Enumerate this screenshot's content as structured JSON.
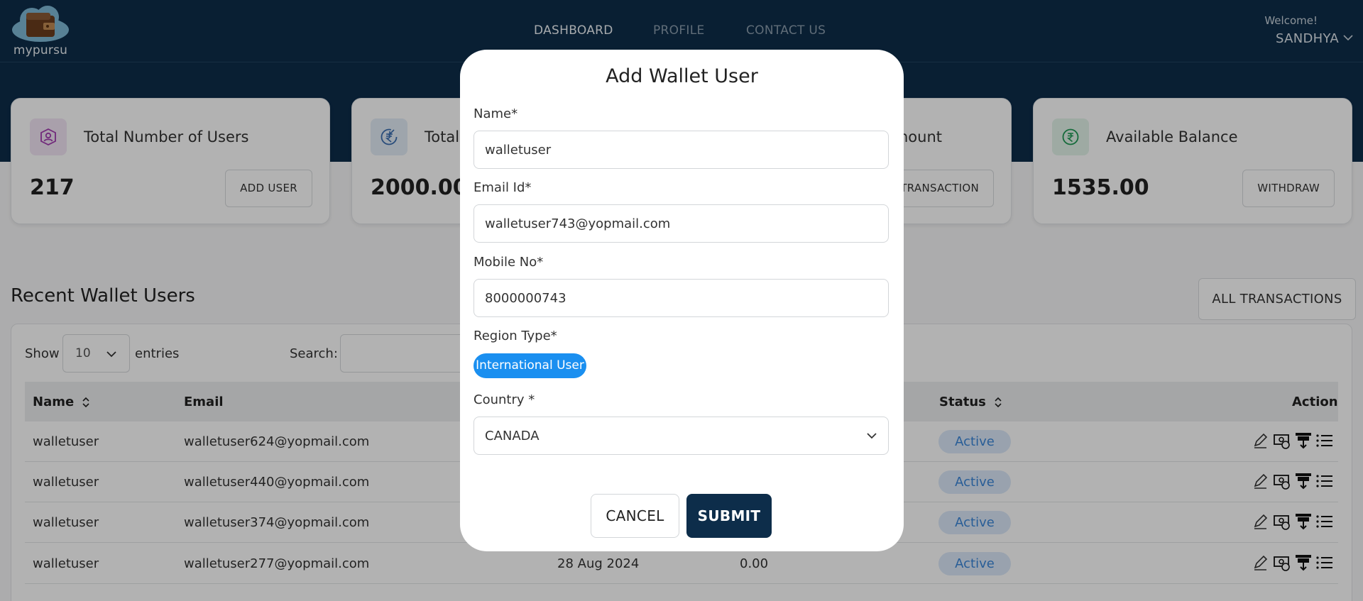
{
  "brand": {
    "name": "mypursu",
    "logo_icon": "wallet-cloud-logo"
  },
  "nav": [
    {
      "label": "DASHBOARD",
      "active": true
    },
    {
      "label": "PROFILE",
      "active": false
    },
    {
      "label": "CONTACT US",
      "active": false
    }
  ],
  "user": {
    "welcome": "Welcome!",
    "name": "SANDHYA"
  },
  "cards": [
    {
      "title": "Total Number of Users",
      "value": "217",
      "button": "ADD USER",
      "icon": "user-badge-icon",
      "icon_color": "#a23bb0",
      "icon_bg": "#f3e6f5"
    },
    {
      "title": "Total",
      "value": "2000.00",
      "button": "",
      "icon": "rupee-refund-icon",
      "icon_color": "#3b6fb0",
      "icon_bg": "#e3ecf7"
    },
    {
      "title": "nount",
      "value": "",
      "button": "TRANSACTION",
      "icon": "",
      "icon_color": "",
      "icon_bg": ""
    },
    {
      "title": "Available Balance",
      "value": "1535.00",
      "button": "WITHDRAW",
      "icon": "rupee-circle-icon",
      "icon_color": "#1f9a55",
      "icon_bg": "#e3f4ea"
    }
  ],
  "recent": {
    "title": "Recent Wallet Users",
    "all_transactions": "ALL TRANSACTIONS",
    "show_label": "Show",
    "page_length": "10",
    "entries_label": "entries",
    "search_label": "Search:"
  },
  "table": {
    "headers": {
      "name": "Name",
      "email": "Email",
      "status": "Status",
      "action": "Action"
    },
    "rows": [
      {
        "name": "walletuser",
        "email": "walletuser624@yopmail.com",
        "date": "",
        "amount": "",
        "status": "Active"
      },
      {
        "name": "walletuser",
        "email": "walletuser440@yopmail.com",
        "date": "",
        "amount": "",
        "status": "Active"
      },
      {
        "name": "walletuser",
        "email": "walletuser374@yopmail.com",
        "date": "",
        "amount": "",
        "status": "Active"
      },
      {
        "name": "walletuser",
        "email": "walletuser277@yopmail.com",
        "date": "28 Aug 2024",
        "amount": "0.00",
        "status": "Active"
      }
    ],
    "action_icons": [
      "edit-icon",
      "money-icon",
      "withdraw-icon",
      "list-icon"
    ]
  },
  "modal": {
    "title": "Add Wallet User",
    "name_label": "Name*",
    "name_value": "walletuser",
    "email_label": "Email Id*",
    "email_value": "walletuser743@yopmail.com",
    "mobile_label": "Mobile No*",
    "mobile_value": "8000000743",
    "region_label": "Region Type*",
    "region_value": "International User",
    "country_label": "Country *",
    "country_value": "CANADA",
    "cancel": "CANCEL",
    "submit": "SUBMIT"
  },
  "colors": {
    "header": "#0d2d4a",
    "accent": "#1a8ff0",
    "status_bg": "#dbe9f9",
    "status_text": "#3a86d9"
  }
}
